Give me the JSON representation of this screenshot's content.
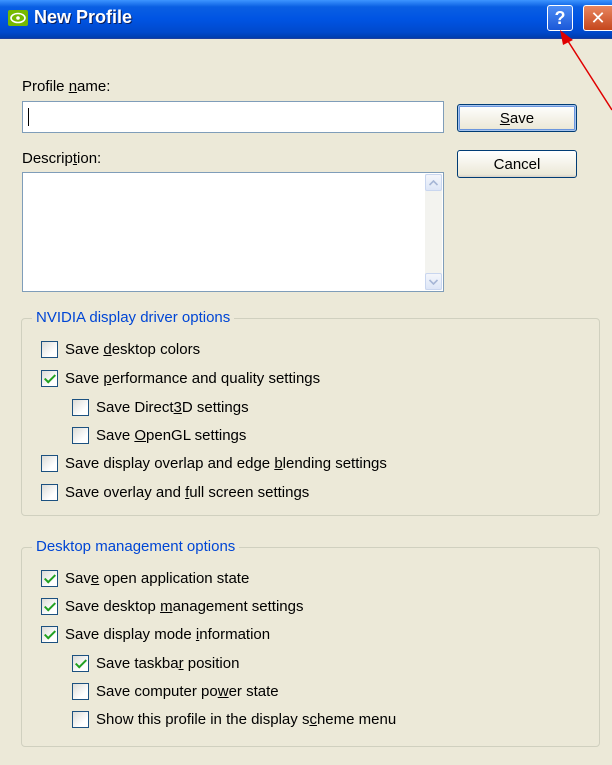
{
  "window": {
    "title": "New Profile",
    "help_glyph": "?",
    "close_glyph": "✕",
    "app_icon": "nvidia-logo-icon"
  },
  "form": {
    "profile_name_label": {
      "pre": "Profile ",
      "key": "n",
      "post": "ame:"
    },
    "profile_name_value": "",
    "description_label": {
      "pre": "Descrip",
      "key": "t",
      "post": "ion:"
    },
    "description_value": ""
  },
  "buttons": {
    "save": {
      "pre": "",
      "key": "S",
      "post": "ave"
    },
    "cancel": "Cancel"
  },
  "nvidia_group": {
    "title": "NVIDIA display driver options",
    "items": [
      {
        "pre": "Save ",
        "key": "d",
        "post": "esktop colors",
        "checked": false
      },
      {
        "pre": "Save ",
        "key": "p",
        "post": "erformance and quality settings",
        "checked": true
      },
      {
        "pre": "Save Direct",
        "key": "3",
        "post": "D settings",
        "checked": false
      },
      {
        "pre": "Save ",
        "key": "O",
        "post": "penGL settings",
        "checked": false
      },
      {
        "pre": "Save display overlap and edge ",
        "key": "b",
        "post": "lending settings",
        "checked": false
      },
      {
        "pre": "Save overlay and ",
        "key": "f",
        "post": "ull screen settings",
        "checked": false
      }
    ]
  },
  "desktop_group": {
    "title": "Desktop management options",
    "items": [
      {
        "pre": "Sav",
        "key": "e",
        "post": " open application state",
        "checked": true
      },
      {
        "pre": "Save desktop ",
        "key": "m",
        "post": "anagement settings",
        "checked": true
      },
      {
        "pre": "Save display mode ",
        "key": "i",
        "post": "nformation",
        "checked": true
      },
      {
        "pre": "Save taskba",
        "key": "r",
        "post": " position",
        "checked": true
      },
      {
        "pre": "Save computer po",
        "key": "w",
        "post": "er state",
        "checked": false
      },
      {
        "pre": "Show this profile in the display s",
        "key": "c",
        "post": "heme menu",
        "checked": false
      }
    ]
  },
  "colors": {
    "titlebar": "#0054e3",
    "dialog_bg": "#ece9d8",
    "group_title": "#0046d5",
    "check": "#21a121",
    "annotation_arrow": "#e00000"
  }
}
